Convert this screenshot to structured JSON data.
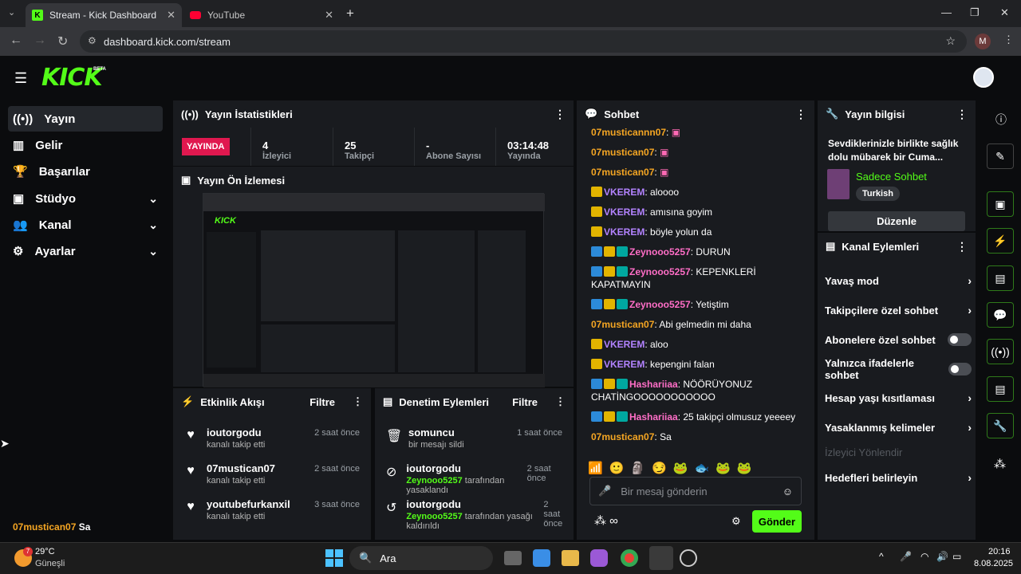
{
  "browser": {
    "tabs": [
      {
        "label": "Stream - Kick Dashboard",
        "active": true
      },
      {
        "label": "YouTube",
        "active": false
      }
    ],
    "url": "dashboard.kick.com/stream",
    "profile_initial": "M"
  },
  "header": {
    "logo": "KICK",
    "beta": "BETA"
  },
  "sidebar": {
    "items": [
      {
        "label": "Yayın",
        "icon": "broadcast-icon",
        "active": true
      },
      {
        "label": "Gelir",
        "icon": "chart-icon"
      },
      {
        "label": "Başarılar",
        "icon": "trophy-icon"
      },
      {
        "label": "Stüdyo",
        "icon": "studio-icon",
        "expandable": true
      },
      {
        "label": "Kanal",
        "icon": "users-icon",
        "expandable": true
      },
      {
        "label": "Ayarlar",
        "icon": "gear-icon",
        "expandable": true
      }
    ],
    "footer_user": "07mustican07",
    "footer_msg": "Sa"
  },
  "stats": {
    "title": "Yayın İstatistikleri",
    "live_badge": "YAYINDA",
    "cells": [
      {
        "value": "4",
        "label": "İzleyici"
      },
      {
        "value": "25",
        "label": "Takipçi"
      },
      {
        "value": "-",
        "label": "Abone Sayısı"
      },
      {
        "value": "03:14:48",
        "label": "Yayında"
      }
    ]
  },
  "preview": {
    "title": "Yayın Ön İzlemesi"
  },
  "activity": {
    "title": "Etkinlik Akışı",
    "filter": "Filtre",
    "items": [
      {
        "name": "ioutorgodu",
        "desc": "kanalı takip etti",
        "time": "2 saat önce"
      },
      {
        "name": "07mustican07",
        "desc": "kanalı takip etti",
        "time": "2 saat önce"
      },
      {
        "name": "youtubefurkanxil",
        "desc": "kanalı takip etti",
        "time": "3 saat önce"
      }
    ]
  },
  "moderation": {
    "title": "Denetim Eylemleri",
    "filter": "Filtre",
    "items": [
      {
        "name": "somuncu",
        "desc": "bir mesajı sildi",
        "actor": "",
        "time": "1 saat önce",
        "icon": "trash-icon"
      },
      {
        "name": "ioutorgodu",
        "actor": "Zeynooo5257",
        "desc": "tarafından yasaklandı",
        "time": "2 saat önce",
        "icon": "ban-icon"
      },
      {
        "name": "ioutorgodu",
        "actor": "Zeynooo5257",
        "desc": "tarafından yasağı kaldırıldı",
        "time": "2 saat önce",
        "icon": "undo-icon"
      }
    ]
  },
  "chat": {
    "title": "Sohbet",
    "placeholder": "Bir mesaj gönderin",
    "send": "Gönder",
    "messages": [
      {
        "user": "07musticannn07",
        "text": "",
        "color": "#f5a623",
        "badges": []
      },
      {
        "user": "07mustican07",
        "text": "",
        "color": "#f5a623",
        "badges": []
      },
      {
        "user": "07mustican07",
        "text": "",
        "color": "#f5a623",
        "badges": []
      },
      {
        "user": "VKEREM",
        "text": "aloooo",
        "color": "#b383ff",
        "badges": [
          "crown"
        ]
      },
      {
        "user": "VKEREM",
        "text": "amısına goyim",
        "color": "#b383ff",
        "badges": [
          "crown"
        ]
      },
      {
        "user": "VKEREM",
        "text": "böyle yolun da",
        "color": "#b383ff",
        "badges": [
          "crown"
        ]
      },
      {
        "user": "Zeynooo5257",
        "text": "DURUN",
        "color": "#ff6ec7",
        "badges": [
          "mod",
          "crown",
          "sub"
        ]
      },
      {
        "user": "Zeynooo5257",
        "text": "KEPENKLERİ KAPATMAYIN",
        "color": "#ff6ec7",
        "badges": [
          "mod",
          "crown",
          "sub"
        ]
      },
      {
        "user": "Zeynooo5257",
        "text": "Yetiştim",
        "color": "#ff6ec7",
        "badges": [
          "mod",
          "crown",
          "sub"
        ]
      },
      {
        "user": "07mustican07",
        "text": "Abi gelmedin mi daha",
        "color": "#f5a623",
        "badges": []
      },
      {
        "user": "VKEREM",
        "text": "aloo",
        "color": "#b383ff",
        "badges": [
          "crown"
        ]
      },
      {
        "user": "VKEREM",
        "text": "kepengini falan",
        "color": "#b383ff",
        "badges": [
          "crown"
        ]
      },
      {
        "user": "Hashariiaa",
        "text": "NÖÖRÜYONUZ CHATİNGOOOOOOOOOOO",
        "color": "#ff6ec7",
        "badges": [
          "mod",
          "crown",
          "sub"
        ]
      },
      {
        "user": "Hashariiaa",
        "text": "25 takipçi olmusuz yeeeey",
        "color": "#ff6ec7",
        "badges": [
          "mod",
          "crown",
          "sub"
        ]
      },
      {
        "user": "07mustican07",
        "text": "Sa",
        "color": "#f5a623",
        "badges": []
      }
    ]
  },
  "stream_info": {
    "title": "Yayın bilgisi",
    "stream_title": "Sevdiklerinizle birlikte sağlık dolu mübarek bir Cuma...",
    "category": "Sadece Sohbet",
    "language": "Turkish",
    "edit": "Düzenle"
  },
  "channel_actions": {
    "title": "Kanal Eylemleri",
    "items": [
      {
        "label": "Yavaş mod",
        "kind": "chevron"
      },
      {
        "label": "Takipçilere özel sohbet",
        "kind": "chevron"
      },
      {
        "label": "Abonelere özel sohbet",
        "kind": "toggle"
      },
      {
        "label": "Yalnızca ifadelerle sohbet",
        "kind": "toggle"
      },
      {
        "label": "Hesap yaşı kısıtlaması",
        "kind": "chevron"
      },
      {
        "label": "Yasaklanmış kelimeler",
        "kind": "chevron"
      },
      {
        "label": "İzleyici Yönlendir",
        "kind": "disabled"
      },
      {
        "label": "Hedefleri belirleyin",
        "kind": "chevron"
      }
    ]
  },
  "taskbar": {
    "weather_temp": "29°C",
    "weather_desc": "Güneşli",
    "weather_badge": "7",
    "search": "Ara",
    "time": "20:16",
    "date": "8.08.2025"
  }
}
